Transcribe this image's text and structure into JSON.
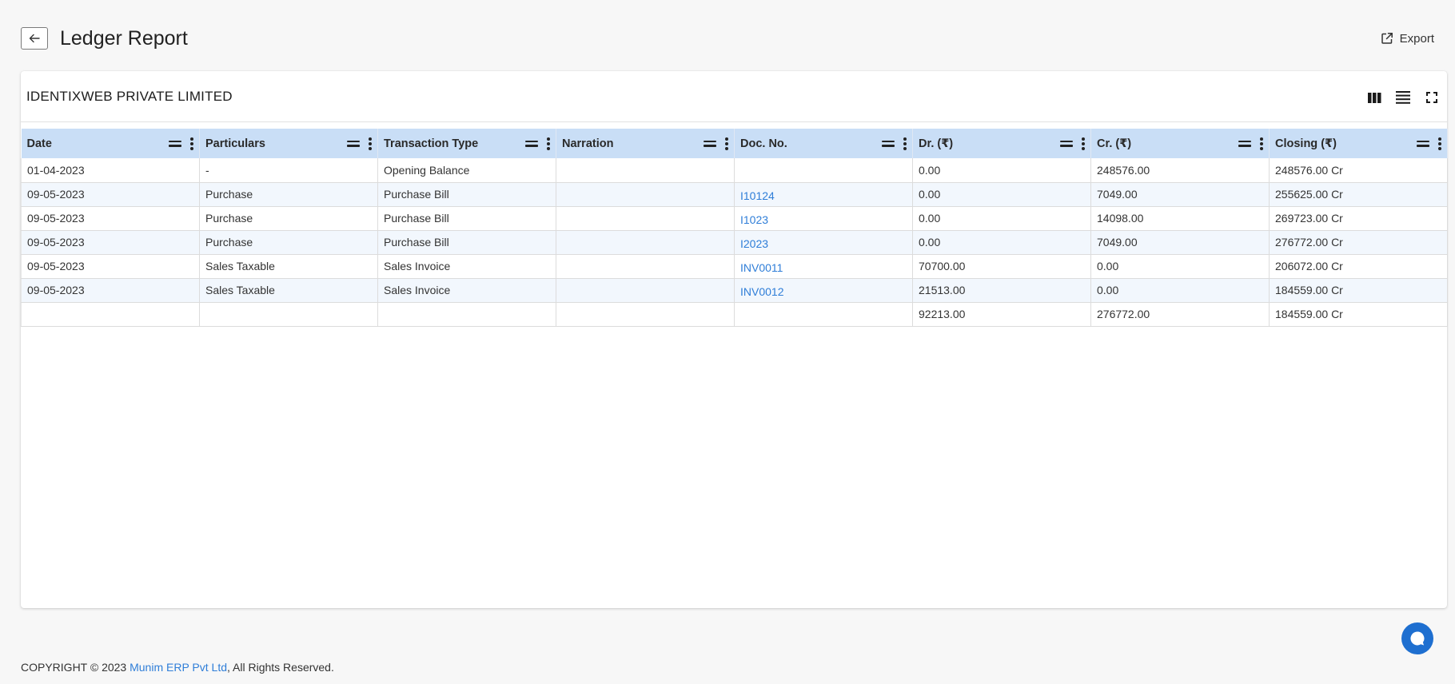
{
  "header": {
    "title": "Ledger Report",
    "export_label": "Export"
  },
  "card": {
    "company": "IDENTIXWEB PRIVATE LIMITED",
    "tools": [
      "columns-icon",
      "density-icon",
      "fullscreen-icon"
    ]
  },
  "table": {
    "columns": [
      "Date",
      "Particulars",
      "Transaction Type",
      "Narration",
      "Doc. No.",
      "Dr. (₹)",
      "Cr. (₹)",
      "Closing (₹)"
    ],
    "rows": [
      [
        "01-04-2023",
        "-",
        "Opening Balance",
        "",
        "",
        "0.00",
        "248576.00",
        "248576.00 Cr"
      ],
      [
        "09-05-2023",
        "Purchase",
        "Purchase Bill",
        "",
        "I10124",
        "0.00",
        "7049.00",
        "255625.00 Cr"
      ],
      [
        "09-05-2023",
        "Purchase",
        "Purchase Bill",
        "",
        "I1023",
        "0.00",
        "14098.00",
        "269723.00 Cr"
      ],
      [
        "09-05-2023",
        "Purchase",
        "Purchase Bill",
        "",
        "I2023",
        "0.00",
        "7049.00",
        "276772.00 Cr"
      ],
      [
        "09-05-2023",
        "Sales Taxable",
        "Sales Invoice",
        "",
        "INV0011",
        "70700.00",
        "0.00",
        "206072.00 Cr"
      ],
      [
        "09-05-2023",
        "Sales Taxable",
        "Sales Invoice",
        "",
        "INV0012",
        "21513.00",
        "0.00",
        "184559.00 Cr"
      ],
      [
        "",
        "",
        "",
        "",
        "",
        "92213.00",
        "276772.00",
        "184559.00 Cr"
      ]
    ]
  },
  "footer": {
    "prefix": "COPYRIGHT © 2023 ",
    "brand": "Munim ERP Pvt Ltd",
    "suffix": ", All Rights Reserved."
  },
  "colors": {
    "accent": "#2f7ed8",
    "header_row": "#c9def6",
    "striped_row": "#f2f7fd",
    "chat_button": "#1e6fd0"
  }
}
